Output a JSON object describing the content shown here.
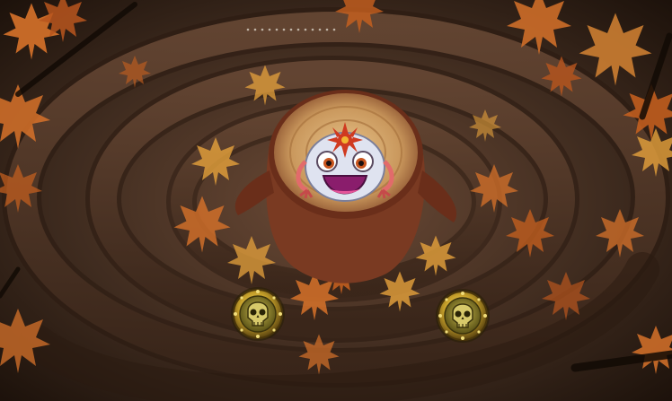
{
  "game": {
    "level_theme": "autumn-forest-stump",
    "shooter": {
      "character": "frog",
      "icon": "frog-shooter-icon",
      "body_color": "#e8eaf4",
      "mouth_color": "#8a1d6c"
    },
    "skull_holes": [
      {
        "icon": "skull-hole-icon"
      },
      {
        "icon": "skull-hole-icon"
      }
    ],
    "path": {
      "style": "carved-spiral-track",
      "color": "#5a3a26"
    },
    "colors": {
      "leaf_orange": "#d7722a",
      "leaf_yellow": "#e6a23c",
      "stump": "#c08e58",
      "bark": "#7a3a22",
      "ground": "#3a2418",
      "gold": "#c6a02a"
    }
  }
}
